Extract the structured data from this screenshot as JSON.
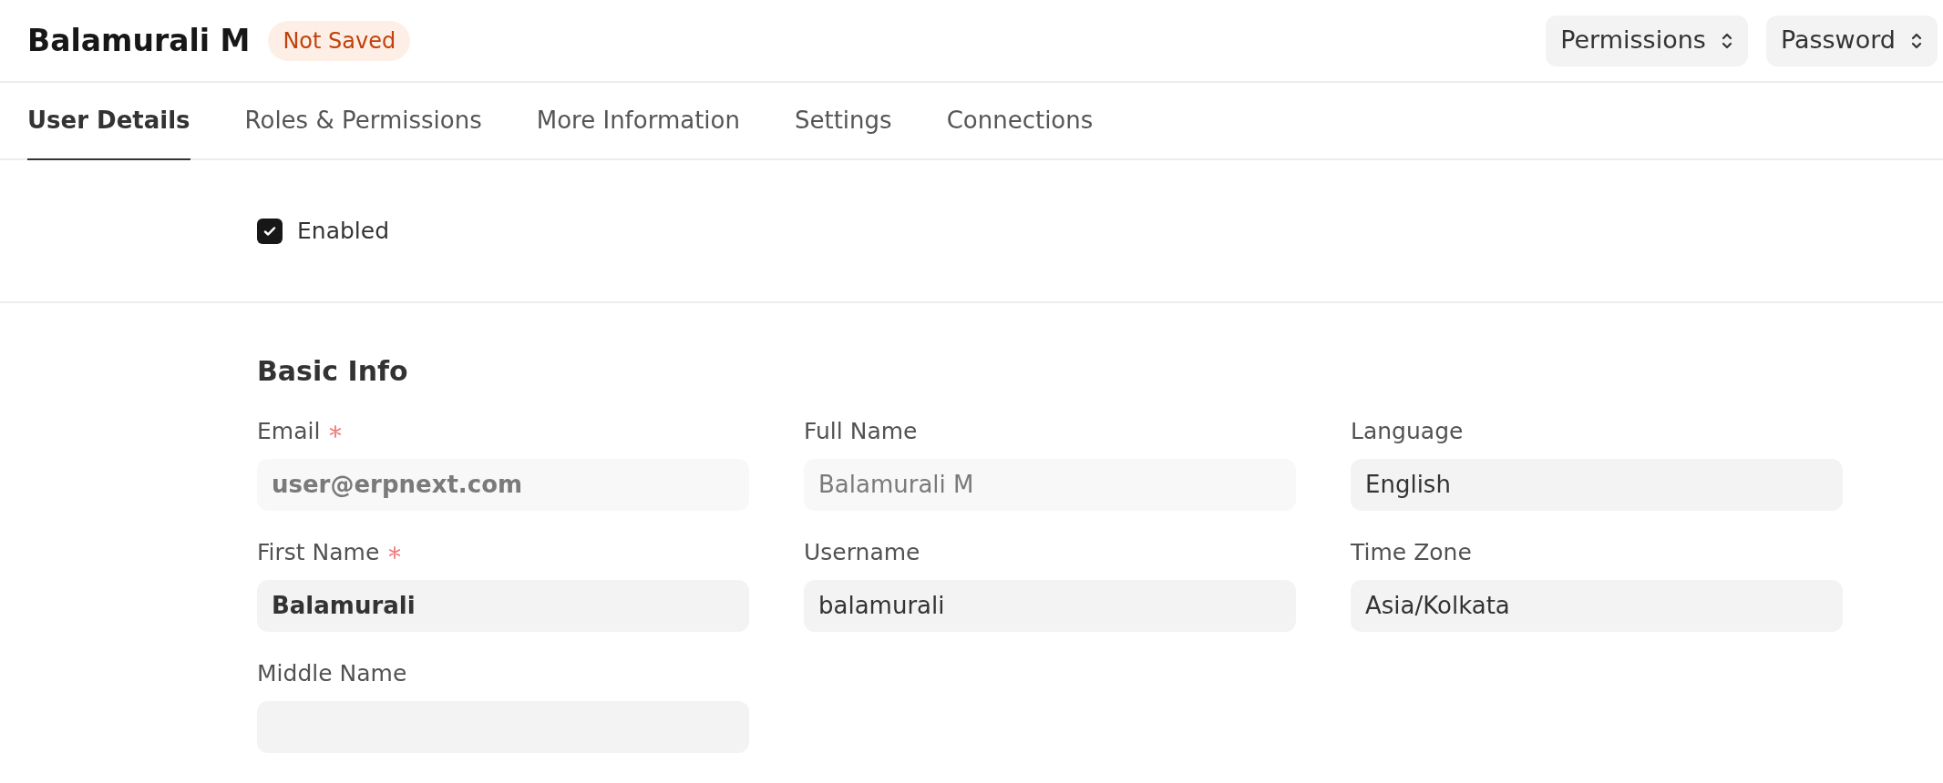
{
  "header": {
    "title": "Balamurali M",
    "status_badge": "Not Saved",
    "buttons": [
      {
        "label": "Permissions"
      },
      {
        "label": "Password"
      }
    ]
  },
  "tabs": [
    {
      "label": "User Details",
      "selected": true
    },
    {
      "label": "Roles & Permissions",
      "selected": false
    },
    {
      "label": "More Information",
      "selected": false
    },
    {
      "label": "Settings",
      "selected": false
    },
    {
      "label": "Connections",
      "selected": false
    }
  ],
  "enabled_checkbox": {
    "label": "Enabled",
    "checked": true
  },
  "basic_info": {
    "heading": "Basic Info",
    "columns": [
      [
        {
          "label": "Email",
          "required": true,
          "read_only": true,
          "bold": true,
          "value": "user@erpnext.com"
        },
        {
          "label": "First Name",
          "required": true,
          "read_only": false,
          "bold": true,
          "value": "Balamurali"
        },
        {
          "label": "Middle Name",
          "required": false
        }
      ],
      [
        {
          "label": "Full Name",
          "required": false,
          "read_only": true,
          "bold": false,
          "value": "Balamurali M"
        },
        {
          "label": "Username",
          "required": false,
          "read_only": false,
          "bold": false,
          "value": "balamurali"
        }
      ],
      [
        {
          "label": "Language",
          "required": false,
          "read_only": false,
          "bold": false,
          "value": "English"
        },
        {
          "label": "Time Zone",
          "required": false,
          "read_only": false,
          "bold": false,
          "value": "Asia/Kolkata"
        }
      ]
    ]
  }
}
